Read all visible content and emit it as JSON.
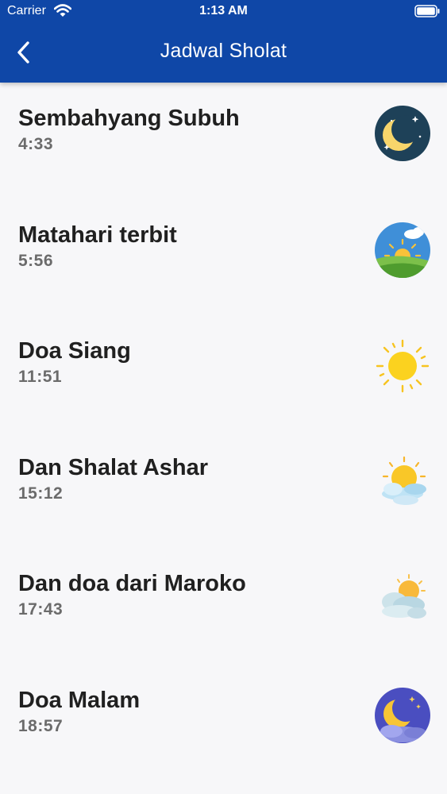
{
  "status_bar": {
    "carrier": "Carrier",
    "time": "1:13 AM"
  },
  "header": {
    "title": "Jadwal Sholat",
    "background_color": "#0f47a7"
  },
  "prayers": [
    {
      "name": "Sembahyang Subuh",
      "time": "4:33",
      "icon": "moon-stars-icon"
    },
    {
      "name": "Matahari terbit",
      "time": "5:56",
      "icon": "sunrise-icon"
    },
    {
      "name": "Doa Siang",
      "time": "11:51",
      "icon": "sun-icon"
    },
    {
      "name": "Dan Shalat Ashar",
      "time": "15:12",
      "icon": "sun-cloud-icon"
    },
    {
      "name": "Dan doa dari Maroko",
      "time": "17:43",
      "icon": "cloudy-sun-icon"
    },
    {
      "name": "Doa Malam",
      "time": "18:57",
      "icon": "night-moon-icon"
    }
  ]
}
